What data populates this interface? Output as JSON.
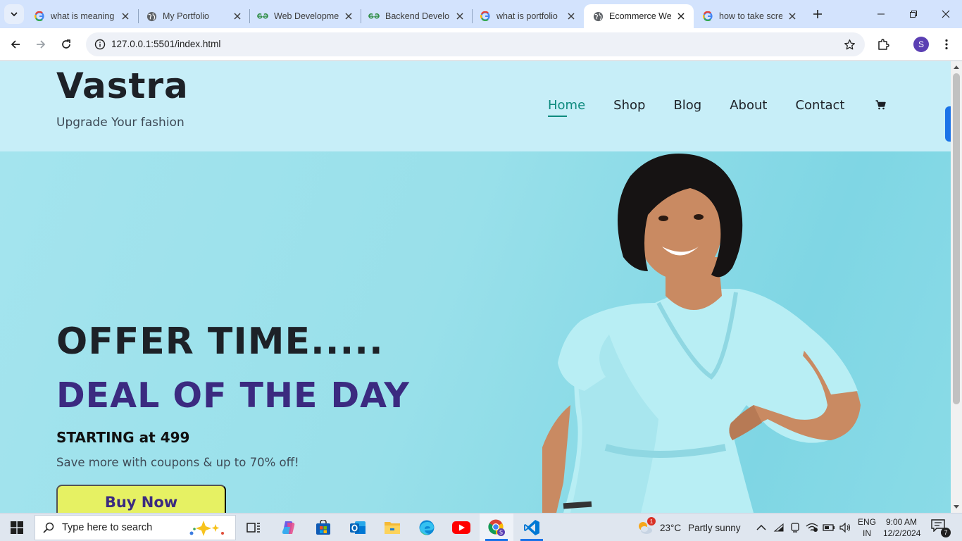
{
  "browser": {
    "tabs": [
      {
        "title": "what is meaning",
        "favicon": "google-icon",
        "active": false
      },
      {
        "title": "My Portfolio",
        "favicon": "globe-icon",
        "active": false
      },
      {
        "title": "Web Developme",
        "favicon": "geeksforgeeks-icon",
        "active": false
      },
      {
        "title": "Backend Develo",
        "favicon": "geeksforgeeks-icon",
        "active": false
      },
      {
        "title": "what is portfolio",
        "favicon": "google-icon",
        "active": false
      },
      {
        "title": "Ecommerce Wel",
        "favicon": "globe-icon",
        "active": true
      },
      {
        "title": "how to take scre",
        "favicon": "google-icon",
        "active": false
      }
    ],
    "url": "127.0.0.1:5501/index.html",
    "profile_initial": "S"
  },
  "site": {
    "brand": "Vastra",
    "tagline": "Upgrade Your fashion",
    "nav": [
      {
        "label": "Home",
        "active": true
      },
      {
        "label": "Shop",
        "active": false
      },
      {
        "label": "Blog",
        "active": false
      },
      {
        "label": "About",
        "active": false
      },
      {
        "label": "Contact",
        "active": false
      }
    ],
    "cart_icon": "cart-icon"
  },
  "hero": {
    "heading": "OFFER TIME.....",
    "subheading": "DEAL OF THE DAY",
    "price_line": "STARTING at 499",
    "description": "Save more with coupons & up to 70% off!",
    "cta": "Buy Now",
    "colors": {
      "heading": "#1d2127",
      "subheading": "#3b2a80",
      "cta_bg": "#e6f163",
      "background": "#9fe1ea"
    }
  },
  "taskbar": {
    "search_placeholder": "Type here to search",
    "weather": {
      "temp": "23°C",
      "condition": "Partly sunny",
      "badge": "1"
    },
    "language": {
      "line1": "ENG",
      "line2": "IN"
    },
    "clock": {
      "time": "9:00 AM",
      "date": "12/2/2024"
    },
    "notification_count": "7"
  }
}
